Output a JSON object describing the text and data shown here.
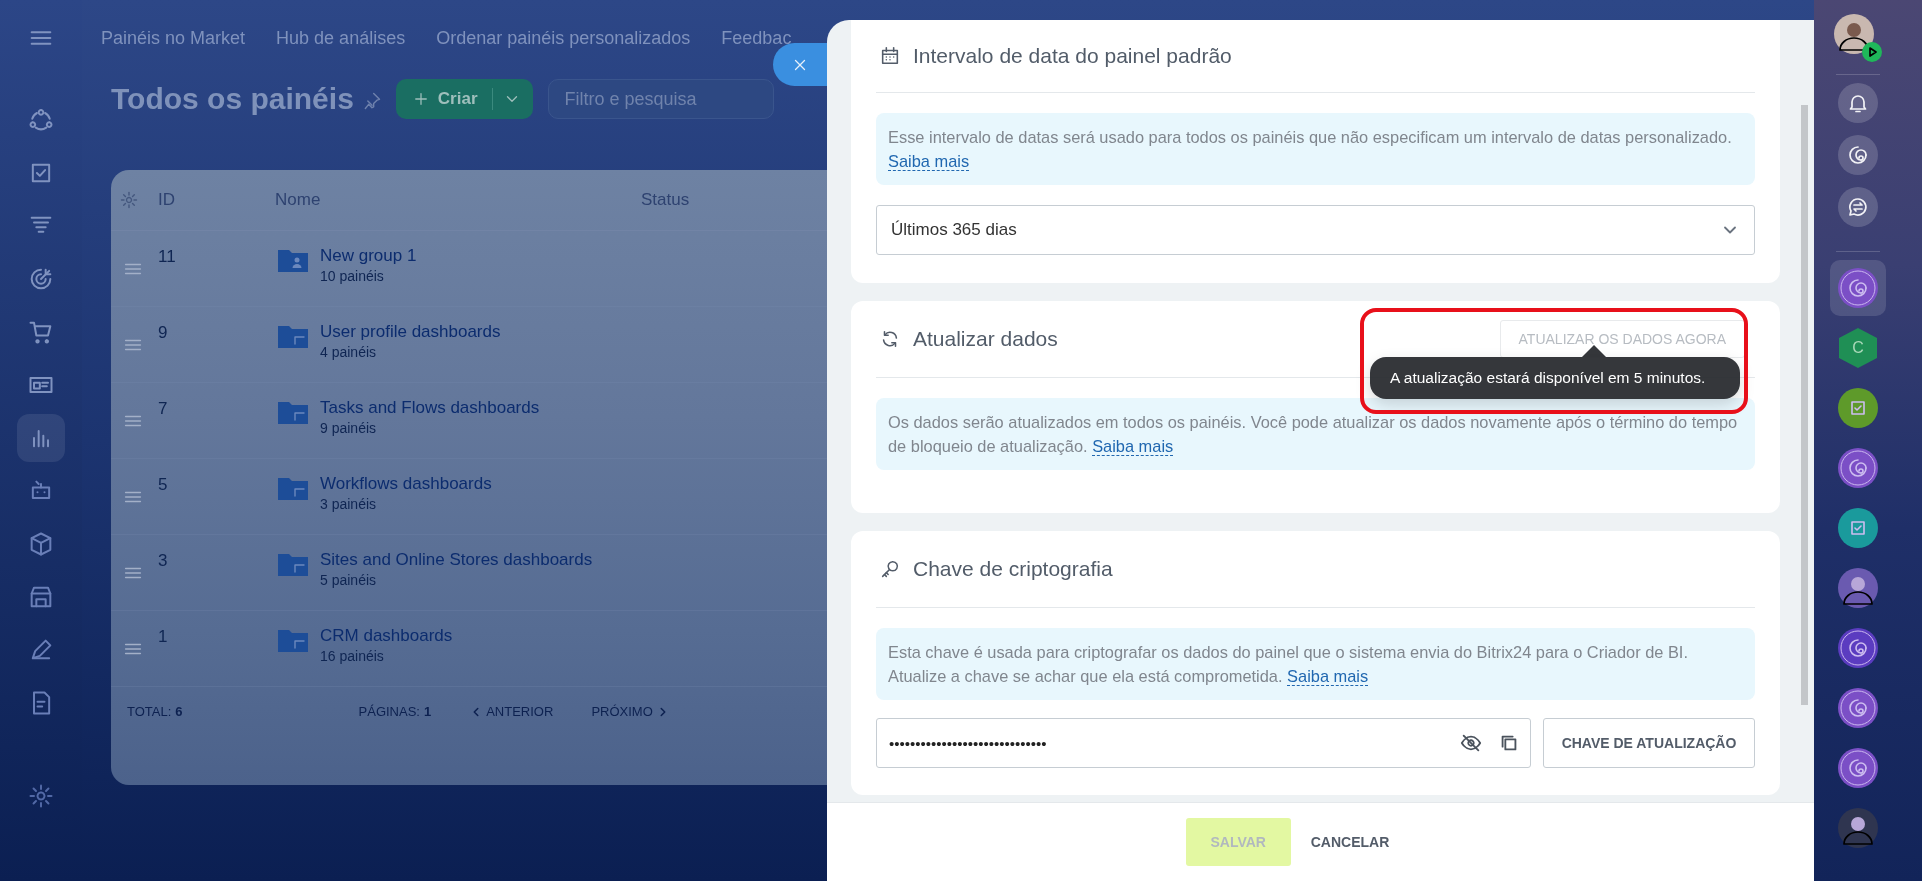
{
  "sidebar": {
    "items": [
      {
        "kind": "flow",
        "selected": false
      },
      {
        "kind": "tasks",
        "selected": false
      },
      {
        "kind": "funnel",
        "selected": false
      },
      {
        "kind": "target",
        "selected": false
      },
      {
        "kind": "cart",
        "selected": false
      },
      {
        "kind": "card",
        "selected": false
      },
      {
        "kind": "chart",
        "selected": true
      },
      {
        "kind": "robot",
        "selected": false
      },
      {
        "kind": "box",
        "selected": false
      },
      {
        "kind": "store",
        "selected": false
      },
      {
        "kind": "pen",
        "selected": false
      },
      {
        "kind": "doc",
        "selected": false
      },
      {
        "kind": "gear",
        "selected": false
      }
    ]
  },
  "top_nav": {
    "links": [
      "Painéis no Market",
      "Hub de análises",
      "Ordenar painéis personalizados",
      "Feedbac"
    ]
  },
  "page": {
    "title": "Todos os painéis",
    "create_button": "Criar",
    "filter": {
      "placeholder": "Filtro e pesquisa"
    }
  },
  "table": {
    "columns": [
      "ID",
      "Nome",
      "Status"
    ],
    "rows": [
      {
        "id": "11",
        "name": "New group 1",
        "count": "10 painéis",
        "kind": "user"
      },
      {
        "id": "9",
        "name": "User profile dashboards",
        "count": "4 painéis",
        "kind": "system"
      },
      {
        "id": "7",
        "name": "Tasks and Flows dashboards",
        "count": "9 painéis",
        "kind": "system"
      },
      {
        "id": "5",
        "name": "Workflows dashboards",
        "count": "3 painéis",
        "kind": "system"
      },
      {
        "id": "3",
        "name": "Sites and Online Stores dashboards",
        "count": "5 painéis",
        "kind": "system"
      },
      {
        "id": "1",
        "name": "CRM dashboards",
        "count": "16 painéis",
        "kind": "system"
      }
    ],
    "footer": {
      "total_label": "TOTAL:",
      "total": "6",
      "pages_label": "PÁGINAS:",
      "pages": "1",
      "prev": "ANTERIOR",
      "next": "PRÓXIMO"
    }
  },
  "settings_panel": {
    "sections": [
      {
        "kind": "date",
        "title": "Intervalo de data do painel padrão",
        "highlighted": false,
        "info": {
          "text": "Esse intervalo de datas será usado para todos os painéis que não especificam um intervalo de datas personalizado.",
          "link": "Saiba mais"
        },
        "select": {
          "value": "Últimos 365 dias"
        }
      },
      {
        "kind": "refresh",
        "title": "Atualizar dados",
        "highlighted": true,
        "button": {
          "label": "ATUALIZAR OS DADOS AGORA",
          "disabled": true
        },
        "info": {
          "text": "Os dados serão atualizados em todos os painéis. Você pode atualizar os dados novamente após o término do tempo de bloqueio de atualização.",
          "link": "Saiba mais"
        },
        "tooltip": "A atualização estará disponível em 5 minutos."
      },
      {
        "kind": "key",
        "title": "Chave de criptografia",
        "highlighted": false,
        "info": {
          "text": "Esta chave é usada para criptografar os dados do painel que o sistema envia do Bitrix24 para o Criador de BI. Atualize a chave se achar que ela está comprometida.",
          "link": "Saiba mais"
        },
        "key_field": {
          "value": "••••••••••••••••••••••••••••••",
          "masked": true
        },
        "button": {
          "label": "CHAVE DE ATUALIZAÇÃO",
          "disabled": false
        }
      }
    ],
    "footer": {
      "save": {
        "label": "SALVAR",
        "disabled": true
      },
      "cancel": "CANCELAR"
    }
  },
  "right_rail": {
    "tools": [
      {
        "kind": "bell"
      },
      {
        "kind": "spiral"
      },
      {
        "kind": "chat"
      }
    ],
    "apps": [
      {
        "kind": "spiral",
        "color": "#7b4fc6",
        "selected": true
      },
      {
        "kind": "hex",
        "label": "C",
        "color": "#1f8f55",
        "selected": false
      },
      {
        "kind": "check",
        "color": "#5e9a2a",
        "selected": false
      },
      {
        "kind": "spiral",
        "color": "#7b4fc6",
        "selected": false
      },
      {
        "kind": "check",
        "color": "#1a9a9c",
        "selected": false
      },
      {
        "kind": "avatar",
        "color": "#6a5ab0",
        "selected": false
      },
      {
        "kind": "spiral",
        "color": "#5b3cc0",
        "selected": false
      },
      {
        "kind": "spiral",
        "color": "#7b4fc6",
        "selected": false
      },
      {
        "kind": "spiral",
        "color": "#7b4fc6",
        "selected": false
      },
      {
        "kind": "avatar",
        "color": "#2f3550",
        "selected": false
      }
    ]
  }
}
